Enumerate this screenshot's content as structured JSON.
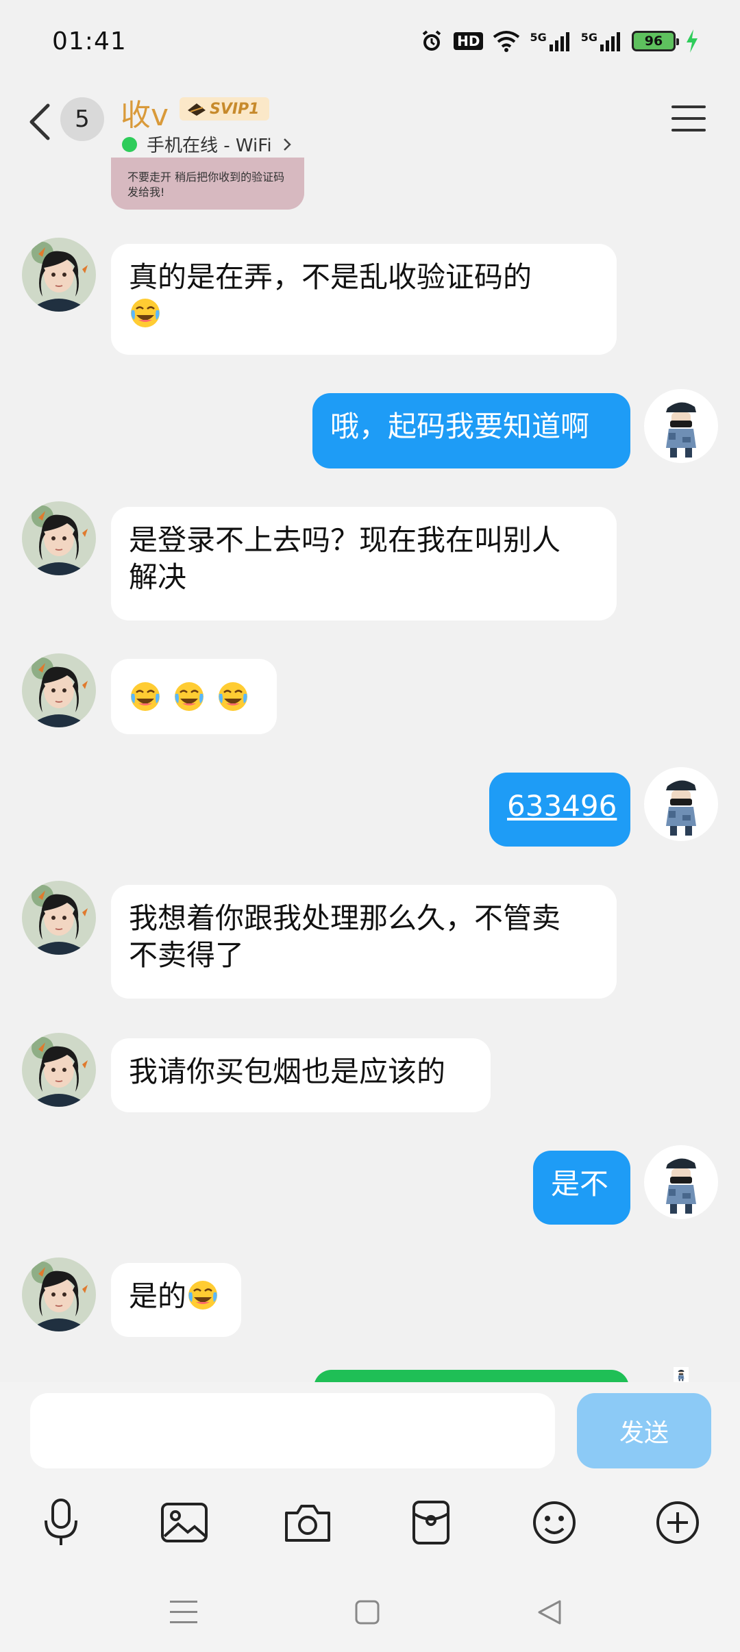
{
  "status_bar": {
    "time": "01:41",
    "hd_label": "HD",
    "signal_1": "5G",
    "signal_2": "5G",
    "battery_level": "96"
  },
  "header": {
    "back_label": "",
    "unread_count": "5",
    "contact_name": "收v",
    "vip_badge": "SVIP1",
    "online_status": "手机在线 - WiFi",
    "online_status_color": "#2ecc5a"
  },
  "image_card": {
    "text": "不要走开 稍后把你收到的验证码发给我!"
  },
  "messages": [
    {
      "side": "in",
      "text": "真的是在弄，不是乱收验证码的",
      "emoji": "laugh-cry"
    },
    {
      "side": "out",
      "text": "哦，起码我要知道啊"
    },
    {
      "side": "in",
      "text_line1": "是登录不上去吗？现在我在叫别人",
      "text_line2": "解决"
    },
    {
      "side": "in",
      "emoji_count": "3",
      "emoji": "laugh-cry"
    },
    {
      "side": "out",
      "text": "633496",
      "is_link": true
    },
    {
      "side": "in",
      "text_line1": "我想着你跟我处理那么久，不管卖",
      "text_line2": "不卖得了"
    },
    {
      "side": "in",
      "text": "我请你买包烟也是应该的"
    },
    {
      "side": "out",
      "text": "是不"
    },
    {
      "side": "in",
      "text": "是的",
      "emoji": "laugh-cry"
    }
  ],
  "composer": {
    "input_value": "",
    "send_label": "发送"
  },
  "toolbar": {
    "icons": [
      "microphone-icon",
      "image-icon",
      "camera-icon",
      "red-packet-icon",
      "emoji-icon",
      "plus-icon"
    ]
  },
  "colors": {
    "outgoing_bubble": "#1e9cf6",
    "incoming_bubble": "#ffffff",
    "send_button": "#8ccaf6",
    "name_color": "#d99a3a"
  }
}
